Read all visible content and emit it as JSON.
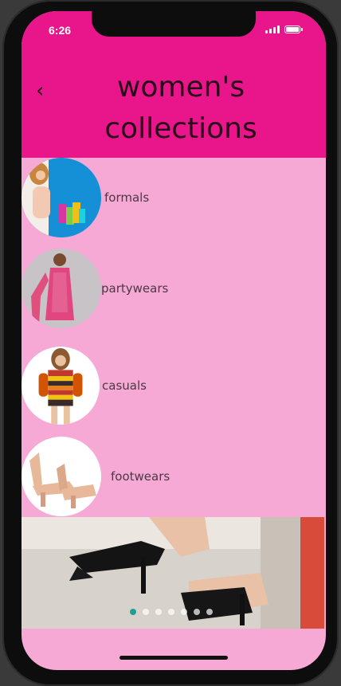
{
  "status_bar": {
    "time": "6:26"
  },
  "header": {
    "back_icon": "chevron-left-icon",
    "title": "women's collections"
  },
  "categories": [
    {
      "label": "formals"
    },
    {
      "label": "partywears"
    },
    {
      "label": "casuals"
    },
    {
      "label": "footwears"
    }
  ],
  "carousel": {
    "dot_count": 7,
    "active_index": 0
  }
}
